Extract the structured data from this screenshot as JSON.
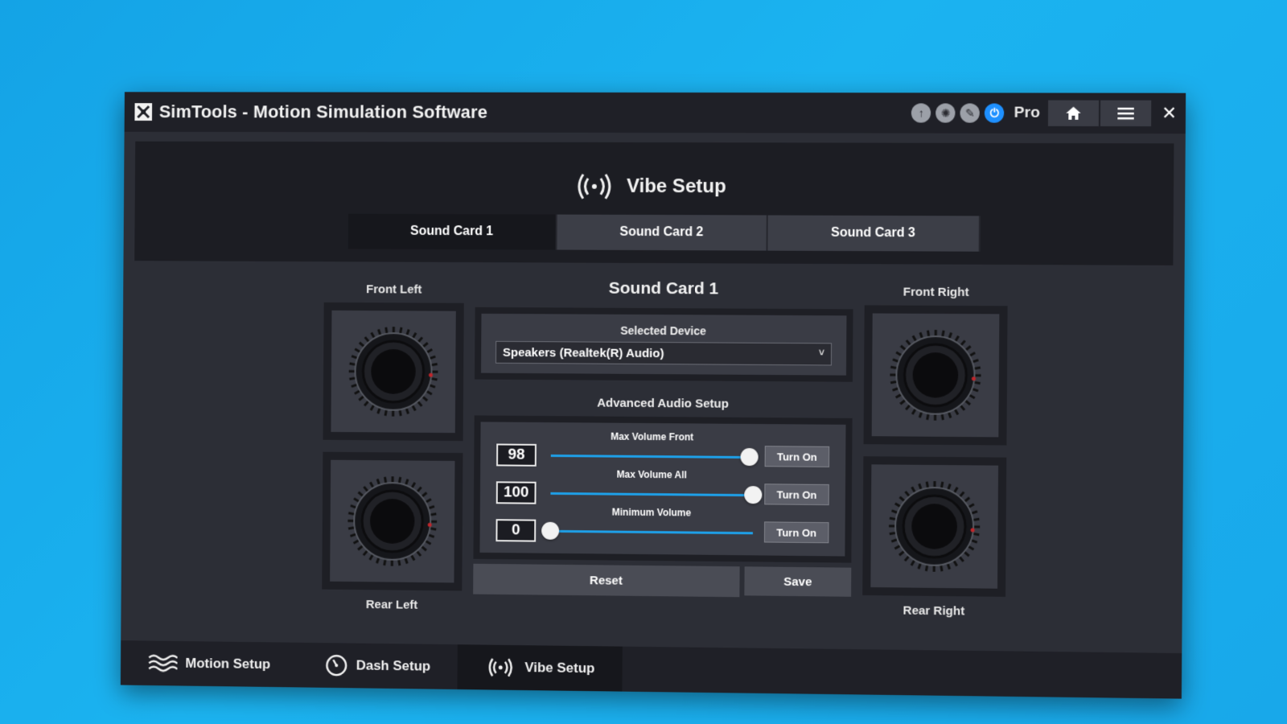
{
  "window": {
    "title": "SimTools - Motion Simulation Software",
    "edition": "Pro"
  },
  "header": {
    "title": "Vibe Setup",
    "tabs": [
      {
        "label": "Sound Card 1",
        "active": true
      },
      {
        "label": "Sound Card 2",
        "active": false
      },
      {
        "label": "Sound Card 3",
        "active": false
      }
    ]
  },
  "speakers": {
    "front_left": "Front Left",
    "front_right": "Front Right",
    "rear_left": "Rear Left",
    "rear_right": "Rear Right"
  },
  "main": {
    "title": "Sound Card 1",
    "device_label": "Selected Device",
    "device_value": "Speakers (Realtek(R) Audio)",
    "advanced_label": "Advanced Audio Setup",
    "sliders": [
      {
        "label": "Max Volume Front",
        "value": "98",
        "fraction": 0.98,
        "button": "Turn On"
      },
      {
        "label": "Max Volume All",
        "value": "100",
        "fraction": 1.0,
        "button": "Turn On"
      },
      {
        "label": "Minimum Volume",
        "value": "0",
        "fraction": 0.0,
        "button": "Turn On"
      }
    ],
    "reset_label": "Reset",
    "save_label": "Save"
  },
  "footer": {
    "tabs": [
      {
        "label": "Motion Setup",
        "icon": "waves-icon"
      },
      {
        "label": "Dash Setup",
        "icon": "gauge-icon"
      },
      {
        "label": "Vibe Setup",
        "icon": "vibration-icon",
        "active": true
      }
    ]
  },
  "colors": {
    "accent": "#1ea0e8",
    "desktop": "#1bb3f0"
  }
}
